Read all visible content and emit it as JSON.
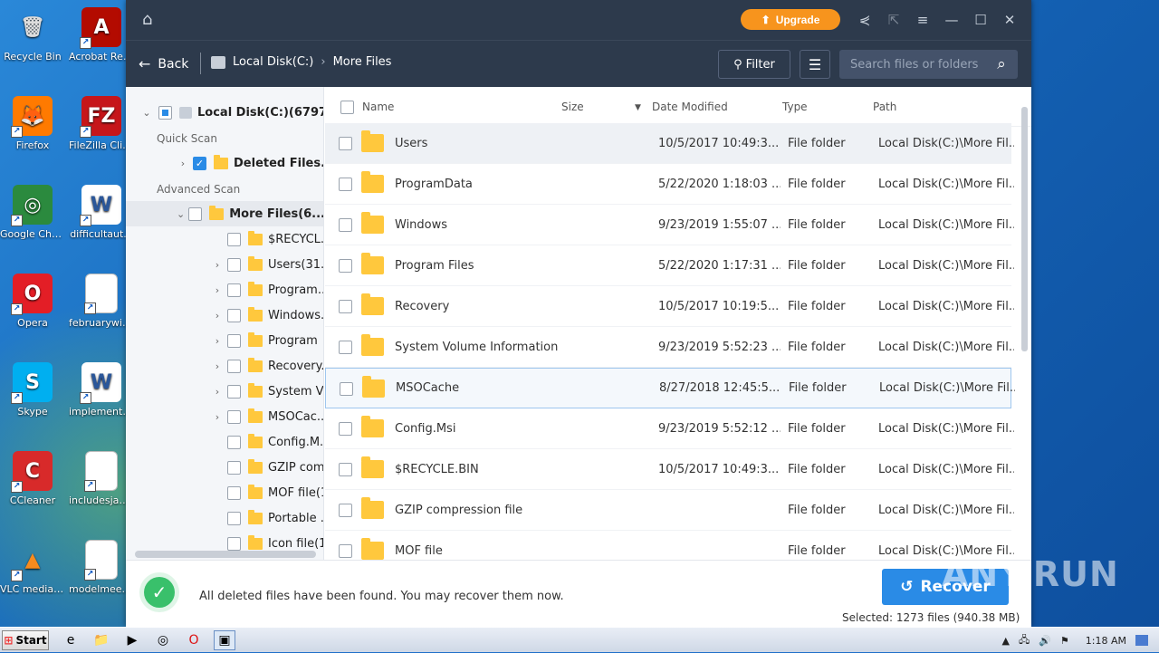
{
  "desktop": {
    "icons": [
      {
        "label": "Recycle Bin",
        "glyph": "🗑",
        "bg": "transparent",
        "color": "#ddd"
      },
      {
        "label": "Acrobat Reader DC",
        "glyph": "A",
        "bg": "#b30b00",
        "color": "#fff"
      },
      {
        "label": "Firefox",
        "glyph": "🦊",
        "bg": "#ff7a00",
        "color": "#fff"
      },
      {
        "label": "FileZilla Client",
        "glyph": "FZ",
        "bg": "#c6161a",
        "color": "#fff"
      },
      {
        "label": "Google Chrome",
        "glyph": "◎",
        "bg": "#2b8a3e",
        "color": "#fff"
      },
      {
        "label": "difficultaut...",
        "glyph": "W",
        "bg": "#ffffff",
        "color": "#2b579a"
      },
      {
        "label": "Opera",
        "glyph": "O",
        "bg": "#e31e26",
        "color": "#fff"
      },
      {
        "label": "februarywin...",
        "glyph": "",
        "bg": "blank",
        "color": "#000"
      },
      {
        "label": "Skype",
        "glyph": "S",
        "bg": "#00aff0",
        "color": "#fff"
      },
      {
        "label": "implementat...",
        "glyph": "W",
        "bg": "#ffffff",
        "color": "#2b579a"
      },
      {
        "label": "CCleaner",
        "glyph": "C",
        "bg": "#d82a2a",
        "color": "#fff"
      },
      {
        "label": "includesjapa...",
        "glyph": "",
        "bg": "blank",
        "color": "#000"
      },
      {
        "label": "VLC media player",
        "glyph": "▲",
        "bg": "transparent",
        "color": "#f78b1e"
      },
      {
        "label": "modelmeetin...",
        "glyph": "",
        "bg": "blank",
        "color": "#000"
      }
    ]
  },
  "titlebar": {
    "upgrade_label": "Upgrade"
  },
  "navbar": {
    "back_label": "Back",
    "crumb_root": "Local Disk(C:)",
    "crumb_current": "More Files",
    "filter_label": "Filter",
    "search_placeholder": "Search files or folders"
  },
  "tree": {
    "root": "Local Disk(C:)(67973",
    "quick_scan": "Quick Scan",
    "deleted": "Deleted Files...",
    "advanced_scan": "Advanced Scan",
    "more_files": "More Files(6...",
    "children": [
      {
        "label": "$RECYCL...",
        "arrow": false
      },
      {
        "label": "Users(31...",
        "arrow": true
      },
      {
        "label": "Program...",
        "arrow": true
      },
      {
        "label": "Windows...",
        "arrow": true
      },
      {
        "label": "Program ",
        "arrow": true
      },
      {
        "label": "Recovery...",
        "arrow": true
      },
      {
        "label": "System V...",
        "arrow": true
      },
      {
        "label": "MSOCac...",
        "arrow": true
      },
      {
        "label": "Config.M...",
        "arrow": false
      },
      {
        "label": "GZIP com",
        "arrow": false
      },
      {
        "label": "MOF file(1",
        "arrow": false
      },
      {
        "label": "Portable ...",
        "arrow": false
      },
      {
        "label": "Icon file(1",
        "arrow": false
      }
    ]
  },
  "table": {
    "headers": {
      "name": "Name",
      "size": "Size",
      "date": "Date Modified",
      "type": "Type",
      "path": "Path"
    },
    "rows": [
      {
        "name": "Users",
        "date": "10/5/2017 10:49:3...",
        "type": "File folder",
        "path": "Local Disk(C:)\\More Fil..."
      },
      {
        "name": "ProgramData",
        "date": "5/22/2020 1:18:03 ...",
        "type": "File folder",
        "path": "Local Disk(C:)\\More Fil..."
      },
      {
        "name": "Windows",
        "date": "9/23/2019 1:55:07 ...",
        "type": "File folder",
        "path": "Local Disk(C:)\\More Fil..."
      },
      {
        "name": "Program Files",
        "date": "5/22/2020 1:17:31 ...",
        "type": "File folder",
        "path": "Local Disk(C:)\\More Fil..."
      },
      {
        "name": "Recovery",
        "date": "10/5/2017 10:19:5...",
        "type": "File folder",
        "path": "Local Disk(C:)\\More Fil..."
      },
      {
        "name": "System Volume Information",
        "date": "9/23/2019 5:52:23 ...",
        "type": "File folder",
        "path": "Local Disk(C:)\\More Fil..."
      },
      {
        "name": "MSOCache",
        "date": "8/27/2018 12:45:5...",
        "type": "File folder",
        "path": "Local Disk(C:)\\More Fil..."
      },
      {
        "name": "Config.Msi",
        "date": "9/23/2019 5:52:12 ...",
        "type": "File folder",
        "path": "Local Disk(C:)\\More Fil..."
      },
      {
        "name": "$RECYCLE.BIN",
        "date": "10/5/2017 10:49:3...",
        "type": "File folder",
        "path": "Local Disk(C:)\\More Fil..."
      },
      {
        "name": "GZIP compression file",
        "date": "",
        "type": "File folder",
        "path": "Local Disk(C:)\\More Fil..."
      },
      {
        "name": "MOF file",
        "date": "",
        "type": "File folder",
        "path": "Local Disk(C:)\\More Fil..."
      }
    ]
  },
  "bottom": {
    "message": "All deleted files have been found. You may recover them now.",
    "recover_label": "Recover",
    "selected_info": "Selected: 1273 files (940.38 MB)"
  },
  "taskbar": {
    "start_label": "Start",
    "time": "1:18 AM"
  },
  "watermark": "ANY.RUN",
  "colors": {
    "accent": "#2a8be6",
    "upgrade": "#f7941d",
    "titlebar": "#2d3a4c",
    "folder": "#ffc83d"
  }
}
